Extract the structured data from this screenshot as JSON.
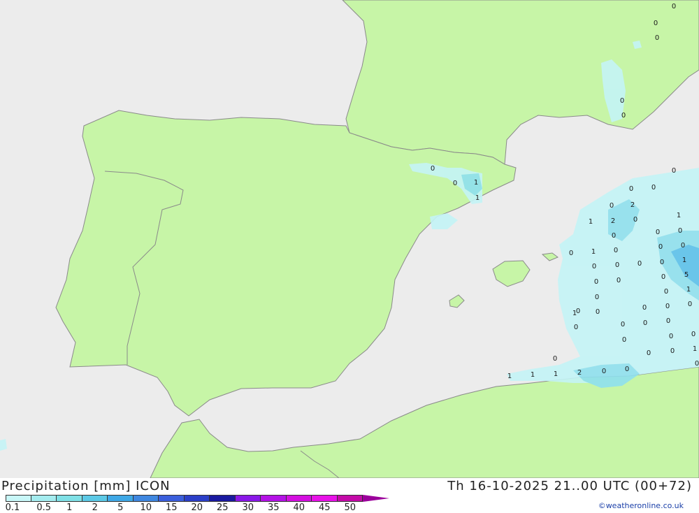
{
  "map": {
    "colors": {
      "sea": "#ececec",
      "land": "#c7f5a7",
      "border": "#8a8a8a",
      "precip_light": "#c4f4f6",
      "precip_mid": "#8fe0ee",
      "precip_strong": "#5cc1ea"
    },
    "value_labels": [
      "0",
      "0",
      "0",
      "0",
      "0",
      "0",
      "0",
      "0",
      "1",
      "1",
      "0",
      "0",
      "0",
      "2",
      "1",
      "2",
      "0",
      "1",
      "0",
      "0",
      "0",
      "0",
      "1",
      "0",
      "0",
      "0",
      "0",
      "0",
      "0",
      "0",
      "1",
      "0",
      "0",
      "5",
      "0",
      "0",
      "1",
      "0",
      "0",
      "0",
      "1",
      "0",
      "0",
      "0",
      "0",
      "0",
      "0",
      "0",
      "0",
      "0",
      "0",
      "0",
      "0",
      "1",
      "0",
      "0",
      "1",
      "1",
      "1",
      "2",
      "0",
      "0"
    ]
  },
  "footer": {
    "title": "Precipitation [mm] ICON",
    "datetime": "Th 16-10-2025 21..00 UTC (00+72)",
    "credit": "©weatheronline.co.uk"
  },
  "legend": {
    "colors": [
      "#c8f7f8",
      "#a4ecef",
      "#7fe0e6",
      "#5cc9e6",
      "#3fa8e6",
      "#3f87e0",
      "#3b5fdc",
      "#2b3fc8",
      "#1a1aa0",
      "#8a18e8",
      "#b412e6",
      "#d40fe0",
      "#e812e8",
      "#c40aa8"
    ],
    "arrow_color": "#9b009b",
    "labels": [
      "0.1",
      "0.5",
      "1",
      "2",
      "5",
      "10",
      "15",
      "20",
      "25",
      "30",
      "35",
      "40",
      "45",
      "50"
    ]
  }
}
